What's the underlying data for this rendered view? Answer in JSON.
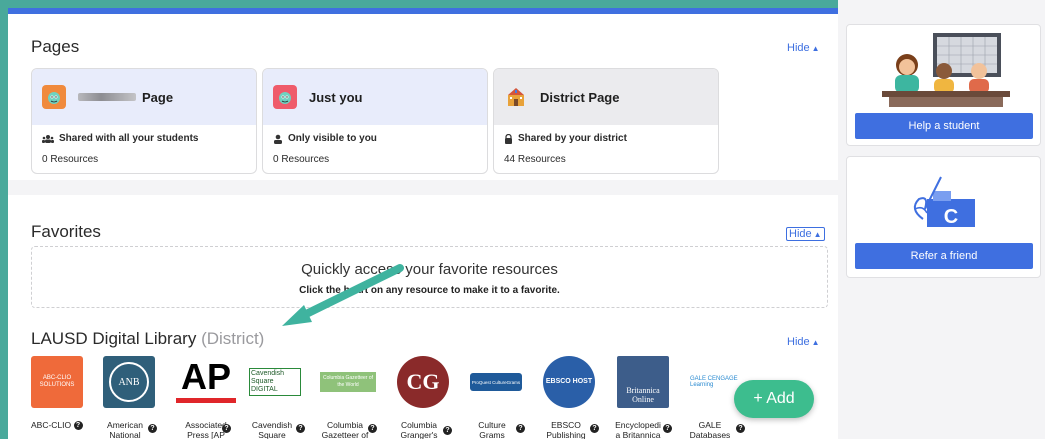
{
  "pages": {
    "title": "Pages",
    "hide_label": "Hide",
    "cards": [
      {
        "title": "Page",
        "sub": "Shared with all your students",
        "count": "0 Resources"
      },
      {
        "title": "Just you",
        "sub": "Only visible to you",
        "count": "0 Resources"
      },
      {
        "title": "District Page",
        "sub": "Shared by your district",
        "count": "44 Resources"
      }
    ]
  },
  "favorites": {
    "title": "Favorites",
    "hide_label": "Hide",
    "empty_main": "Quickly access your favorite resources",
    "empty_sub": "Click the heart on any resource to make it to a favorite."
  },
  "library": {
    "title": "LAUSD Digital Library",
    "scope": "(District)",
    "hide_label": "Hide",
    "items": [
      {
        "label": "ABC-CLIO",
        "logo_text": "ABC-CLIO SOLUTIONS"
      },
      {
        "label": "American National",
        "logo_text": "ANB"
      },
      {
        "label": "Associated Press [AP",
        "logo_text": "AP"
      },
      {
        "label": "Cavendish Square",
        "logo_text": "Cavendish Square DIGITAL"
      },
      {
        "label": "Columbia Gazetteer of",
        "logo_text": "Columbia Gazetteer of the World"
      },
      {
        "label": "Columbia Granger's",
        "logo_text": "CG"
      },
      {
        "label": "Culture Grams",
        "logo_text": "ProQuest CultureGrams"
      },
      {
        "label": "EBSCO Publishing",
        "logo_text": "EBSCO HOST"
      },
      {
        "label": "Encyclopedi a Britannica",
        "logo_text": "Britannica Online"
      },
      {
        "label": "GALE Databases",
        "logo_text": "GALE CENGAGE Learning"
      }
    ],
    "add_label": "+ Add"
  },
  "sidebar": {
    "help_button": "Help a student",
    "refer_button": "Refer a friend",
    "refer_logo_letter": "C"
  },
  "colors": {
    "accent": "#3f6fe0",
    "frame": "#49a99b",
    "add": "#3dbd8e"
  }
}
